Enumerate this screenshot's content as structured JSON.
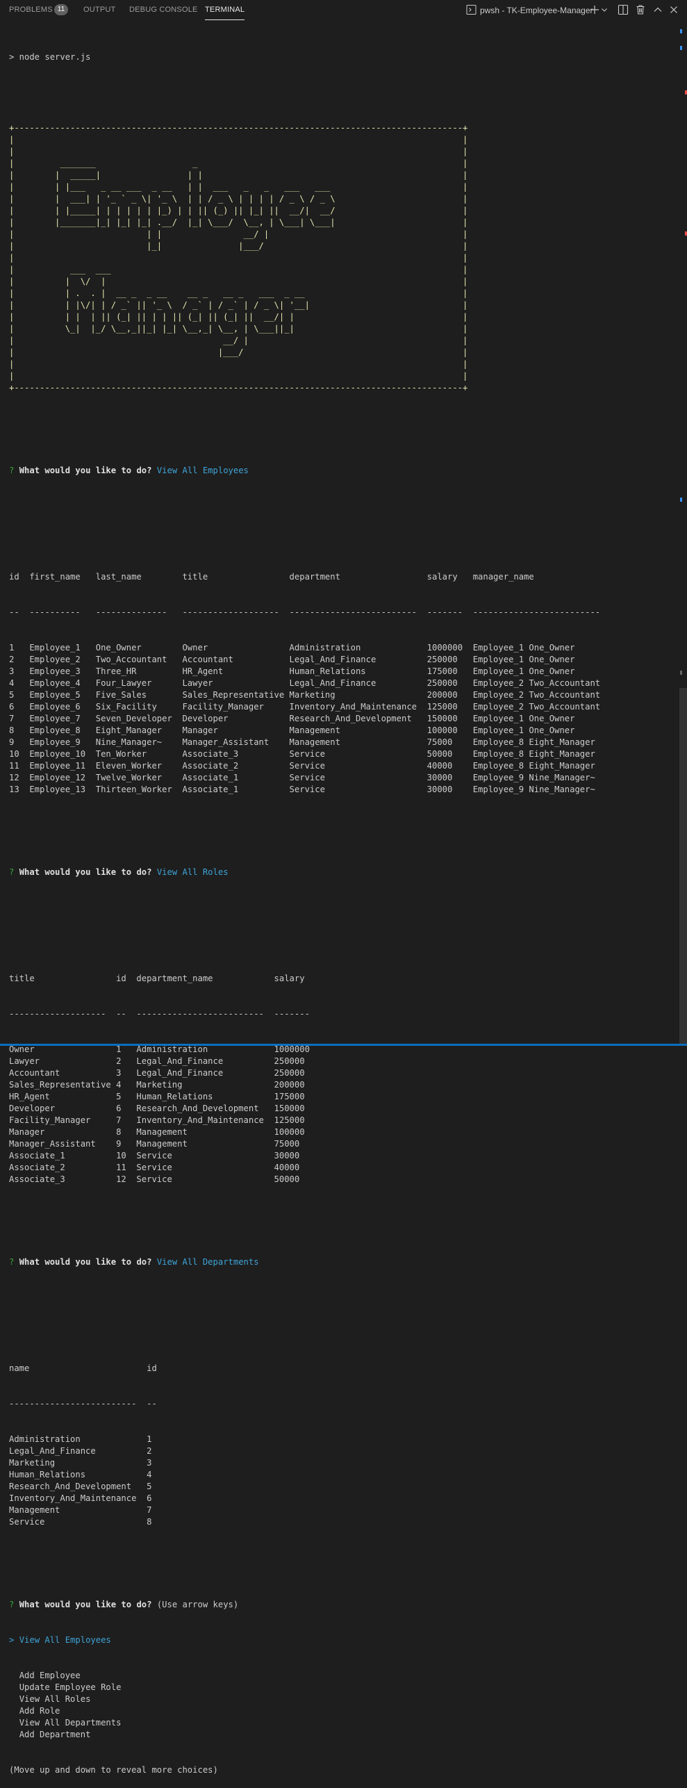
{
  "panel": {
    "tabs": [
      {
        "label": "PROBLEMS",
        "badge": "11"
      },
      {
        "label": "OUTPUT"
      },
      {
        "label": "DEBUG CONSOLE"
      },
      {
        "label": "TERMINAL"
      }
    ],
    "terminal_name": "pwsh - TK-Employee-Manager",
    "icons": [
      "terminal-icon",
      "add-icon",
      "chevron-down-icon",
      "split-icon",
      "trash-icon",
      "maximize-icon",
      "close-icon"
    ]
  },
  "colors": {
    "background": "#1e1e1e",
    "prompt": "#3aa53a",
    "answer": "#3ea4d8",
    "art": "#e5e5b0",
    "accent": "#0b6fbf"
  },
  "terminal": {
    "command": "> node server.js",
    "banner": [
      "+----------------------------------------------------------------------------------------+",
      "|                                                                                        |",
      "|                                                                                        |",
      "|         _______                   _                                                    |",
      "|        |  _____|                 | |                                                   |",
      "|        | |___   _ __ ___  _ __   | |  ___   _   _   ___   ___                          |",
      "|        |  ___| | '_ ` _ \\| '_ \\  | | / _ \\ | | | | / _ \\ / _ \\                         |",
      "|        | |_____| | | | | | |_) | | || (_) || |_| ||  __/|  __/                         |",
      "|        |_______|_| |_| |_| .__/  |_| \\___/  \\__, | \\___| \\___|                         |",
      "|                          | |                __/ |                                      |",
      "|                          |_|               |___/                                       |",
      "|                                                                                        |",
      "|           ___  ___                                                                     |",
      "|          |  \\/  |                                                                      |",
      "|          | .  . |  __ _  _ __    __ _   __ _   ___  _ __                               |",
      "|          | |\\/| | / _` || '_ \\  / _` | / _` | / _ \\| '__|                              |",
      "|          | |  | || (_| || | | || (_| || (_| ||  __/| |                                 |",
      "|          \\_|  |_/ \\__,_||_| |_| \\__,_| \\__, | \\___||_|                                 |",
      "|                                         __/ |                                          |",
      "|                                        |___/                                           |",
      "|                                                                                        |",
      "|                                                                                        |",
      "+----------------------------------------------------------------------------------------+"
    ],
    "prompt_question": "What would you like to do?",
    "prompt_mark": "?",
    "answers": [
      "View All Employees",
      "View All Roles",
      "View All Departments"
    ],
    "employees": {
      "header": "id  first_name   last_name        title                department                 salary   manager_name",
      "divider": "--  ----------   --------------   -------------------  -------------------------  -------  -------------------------",
      "rows": [
        "1   Employee_1   One_Owner        Owner                Administration             1000000  Employee_1 One_Owner",
        "2   Employee_2   Two_Accountant   Accountant           Legal_And_Finance          250000   Employee_1 One_Owner",
        "3   Employee_3   Three_HR         HR_Agent             Human_Relations            175000   Employee_1 One_Owner",
        "4   Employee_4   Four_Lawyer      Lawyer               Legal_And_Finance          250000   Employee_2 Two_Accountant",
        "5   Employee_5   Five_Sales       Sales_Representative Marketing                  200000   Employee_2 Two_Accountant",
        "6   Employee_6   Six_Facility     Facility_Manager     Inventory_And_Maintenance  125000   Employee_2 Two_Accountant",
        "7   Employee_7   Seven_Developer  Developer            Research_And_Development   150000   Employee_1 One_Owner",
        "8   Employee_8   Eight_Manager    Manager              Management                 100000   Employee_1 One_Owner",
        "9   Employee_9   Nine_Manager~    Manager_Assistant    Management                 75000    Employee_8 Eight_Manager",
        "10  Employee_10  Ten_Worker       Associate_3          Service                    50000    Employee_8 Eight_Manager",
        "11  Employee_11  Eleven_Worker    Associate_2          Service                    40000    Employee_8 Eight_Manager",
        "12  Employee_12  Twelve_Worker    Associate_1          Service                    30000    Employee_9 Nine_Manager~",
        "13  Employee_13  Thirteen_Worker  Associate_1          Service                    30000    Employee_9 Nine_Manager~"
      ]
    },
    "roles": {
      "header": "title                id  department_name            salary",
      "divider": "-------------------  --  -------------------------  -------",
      "rows": [
        "Owner                1   Administration             1000000",
        "Lawyer               2   Legal_And_Finance          250000",
        "Accountant           3   Legal_And_Finance          250000",
        "Sales_Representative 4   Marketing                  200000",
        "HR_Agent             5   Human_Relations            175000",
        "Developer            6   Research_And_Development   150000",
        "Facility_Manager     7   Inventory_And_Maintenance  125000",
        "Manager              8   Management                 100000",
        "Manager_Assistant    9   Management                 75000",
        "Associate_1          10  Service                    30000",
        "Associate_2          11  Service                    40000",
        "Associate_3          12  Service                    50000"
      ]
    },
    "departments": {
      "header": "name                       id",
      "divider": "-------------------------  --",
      "rows": [
        "Administration             1",
        "Legal_And_Finance          2",
        "Marketing                  3",
        "Human_Relations            4",
        "Research_And_Development   5",
        "Inventory_And_Maintenance  6",
        "Management                 7",
        "Service                    8"
      ]
    },
    "final_prompt_hint": "(Use arrow keys)",
    "menu": {
      "pointer": ">",
      "selected": "View All Employees",
      "items": [
        "Add Employee",
        "Update Employee Role",
        "View All Roles",
        "Add Role",
        "View All Departments",
        "Add Department"
      ]
    },
    "footer_hint": "(Move up and down to reveal more choices)"
  }
}
